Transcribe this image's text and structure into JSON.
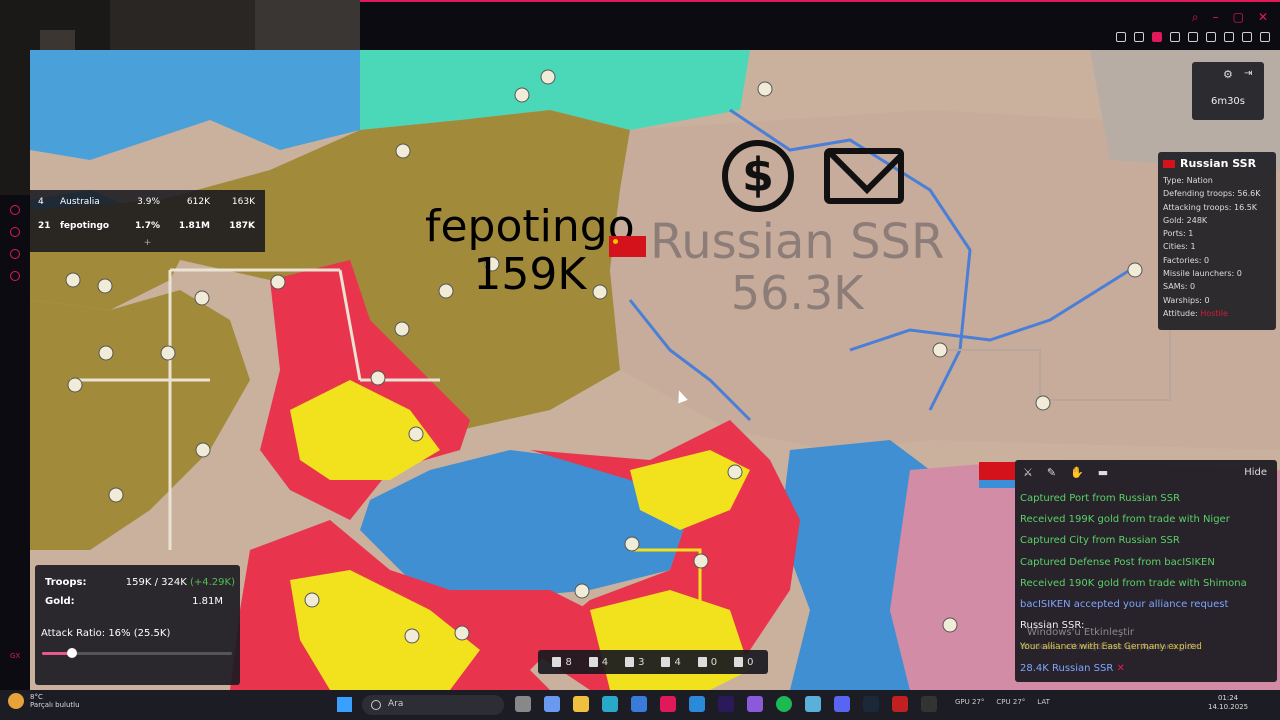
{
  "leaderboard": {
    "rows": [
      {
        "rank": "4",
        "name": "Australia",
        "pct": "3.9%",
        "troops": "612K",
        "gold": "163K"
      },
      {
        "rank": "21",
        "name": "fepotingo",
        "pct": "1.7%",
        "troops": "1.81M",
        "gold": "187K"
      }
    ],
    "expand": "+"
  },
  "map_labels": {
    "player_name": "fepotingo",
    "player_troops": "159K",
    "target_name": "Russian SSR",
    "target_troops": "56.3K"
  },
  "timer": {
    "value": "6m30s"
  },
  "nation_panel": {
    "name": "Russian SSR",
    "type": "Type: Nation",
    "defending": "Defending troops: 56.6K",
    "attacking": "Attacking troops: 16.5K",
    "gold": "Gold: 248K",
    "ports": "Ports: 1",
    "cities": "Cities: 1",
    "factories": "Factories: 0",
    "missiles": "Missile launchers: 0",
    "sams": "SAMs: 0",
    "warships": "Warships: 0",
    "attitude_label": "Attitude:",
    "attitude_value": "Hostile"
  },
  "stats": {
    "troops_label": "Troops:",
    "troops_value": "159K / 324K",
    "troops_delta": "(+4.29K)",
    "gold_label": "Gold:",
    "gold_value": "1.81M",
    "attack_ratio": "Attack Ratio: 16% (25.5K)",
    "attack_ratio_fraction": 0.16
  },
  "units": [
    {
      "name": "cities",
      "count": "8"
    },
    {
      "name": "factories",
      "count": "4"
    },
    {
      "name": "ports",
      "count": "3"
    },
    {
      "name": "defense-posts",
      "count": "4"
    },
    {
      "name": "missile-silos",
      "count": "0"
    },
    {
      "name": "sam-launchers",
      "count": "0"
    }
  ],
  "event_log": {
    "hide": "Hide",
    "events": [
      {
        "text": "Captured Port from Russian SSR",
        "color": "green"
      },
      {
        "text": "Received 199K gold from trade with Niger",
        "color": "green"
      },
      {
        "text": "Captured City from Russian SSR",
        "color": "green"
      },
      {
        "text": "Captured Defense Post from bacISIKEN",
        "color": "green"
      },
      {
        "text": "Received 190K gold from trade with Shimona",
        "color": "green"
      },
      {
        "text": "bacISIKEN accepted your alliance request",
        "color": "blue"
      },
      {
        "text": "Russian SSR:",
        "color": "white"
      },
      {
        "text": "Your alliance with East Germany expired",
        "color": "yellow"
      },
      {
        "text": "28.4K Russian SSR",
        "color": "blue"
      }
    ]
  },
  "watermark": {
    "title": "Windows'u Etkinleştir",
    "sub": "Windows'u etkinleştirmek için Ayarlar'a gidin."
  },
  "taskbar": {
    "weather_temp": "8°C",
    "weather_desc": "Parçalı bulutlu",
    "search": "Ara",
    "gpu": "GPU 27°",
    "cpu": "CPU 27°",
    "lang": "LAT",
    "time": "01:24",
    "date": "14.10.2025"
  }
}
